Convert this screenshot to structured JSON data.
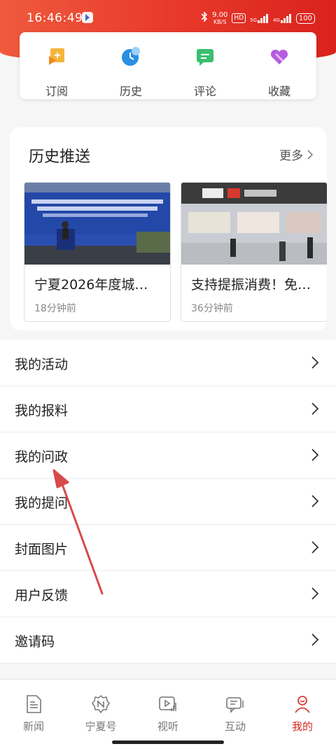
{
  "status_bar": {
    "time": "16:46:49",
    "net_speed_value": "9.00",
    "net_speed_unit": "KB/S",
    "hd_label": "HD",
    "net_5g": "5G",
    "net_4g": "4G",
    "battery": "100"
  },
  "quick_actions": [
    {
      "label": "订阅",
      "icon": "subscribe-icon"
    },
    {
      "label": "历史",
      "icon": "clock-icon"
    },
    {
      "label": "评论",
      "icon": "comment-icon"
    },
    {
      "label": "收藏",
      "icon": "heart-icon"
    }
  ],
  "history": {
    "title": "历史推送",
    "more_label": "更多",
    "items": [
      {
        "title": "宁夏2026年度城…",
        "time": "18分钟前"
      },
      {
        "title": "支持提振消费！免…",
        "time": "36分钟前"
      }
    ]
  },
  "menu": {
    "items": [
      {
        "label": "我的活动"
      },
      {
        "label": "我的报料"
      },
      {
        "label": "我的问政"
      },
      {
        "label": "我的提问"
      },
      {
        "label": "封面图片"
      },
      {
        "label": "用户反馈"
      },
      {
        "label": "邀请码"
      }
    ]
  },
  "bottom_nav": {
    "items": [
      {
        "label": "新闻",
        "icon": "news-icon"
      },
      {
        "label": "宁夏号",
        "icon": "ningxia-account-icon"
      },
      {
        "label": "视听",
        "icon": "video-icon"
      },
      {
        "label": "互动",
        "icon": "chat-icon"
      },
      {
        "label": "我的",
        "icon": "profile-icon"
      }
    ],
    "active_index": 4
  },
  "colors": {
    "brand_red": "#d6281f",
    "annotation_arrow": "#d94a4a"
  }
}
